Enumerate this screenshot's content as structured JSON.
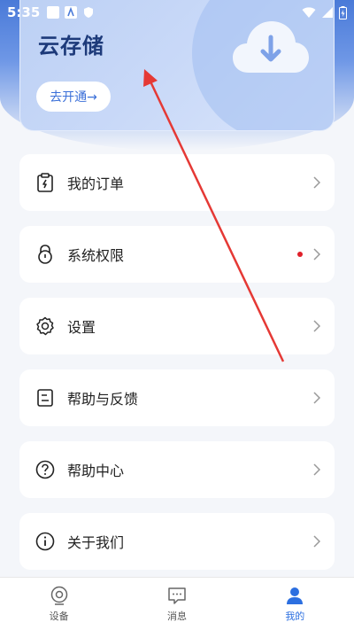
{
  "status_bar": {
    "time": "5:35"
  },
  "cloud_card": {
    "title": "云存储",
    "button_label": "去开通→"
  },
  "menu_items": [
    {
      "label": "我的订单",
      "icon": "order-clipboard-icon"
    },
    {
      "label": "系统权限",
      "icon": "lock-icon",
      "has_badge": true
    },
    {
      "label": "设置",
      "icon": "gear-icon"
    },
    {
      "label": "帮助与反馈",
      "icon": "feedback-doc-icon"
    },
    {
      "label": "帮助中心",
      "icon": "help-question-icon"
    },
    {
      "label": "关于我们",
      "icon": "info-icon"
    }
  ],
  "tabbar": {
    "tabs": [
      {
        "label": "设备",
        "icon": "device-camera-icon"
      },
      {
        "label": "消息",
        "icon": "message-icon"
      },
      {
        "label": "我的",
        "icon": "person-icon",
        "active": true
      }
    ]
  },
  "colors": {
    "accent": "#2c6fe0",
    "badge": "#e0202a",
    "annotation_arrow": "#e53935"
  }
}
